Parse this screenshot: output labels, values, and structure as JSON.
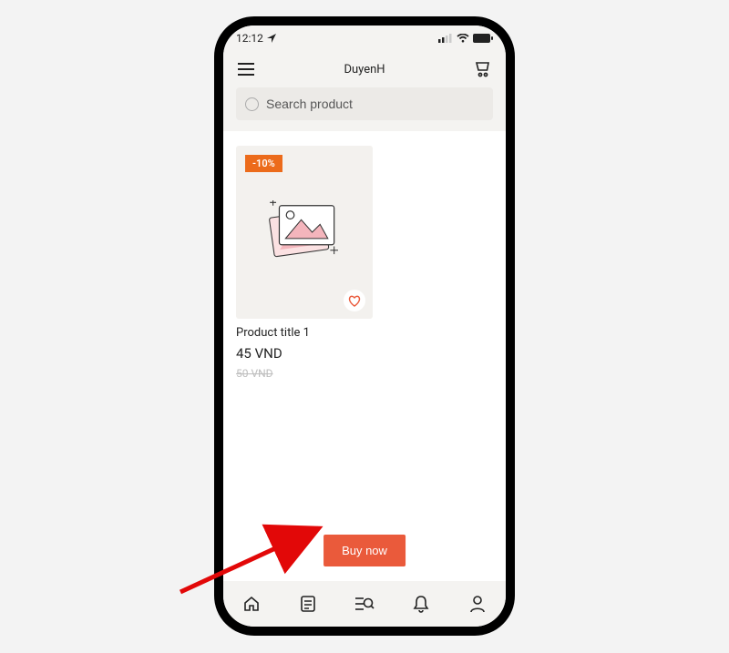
{
  "status": {
    "time": "12:12"
  },
  "header": {
    "title": "DuyenH"
  },
  "search": {
    "placeholder": "Search product"
  },
  "product": {
    "badge": "-10%",
    "title": "Product title 1",
    "price": "45 VND",
    "old_price": "50 VND"
  },
  "actions": {
    "buy_now_label": "Buy now"
  }
}
